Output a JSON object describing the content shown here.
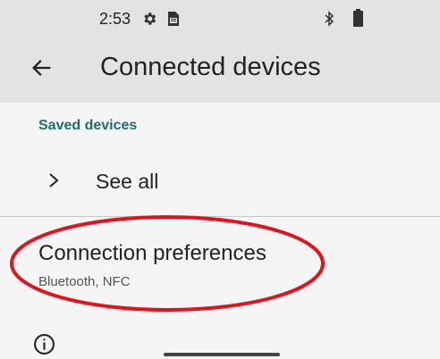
{
  "status_bar": {
    "time": "2:53",
    "icons": [
      "settings-gear-icon",
      "sim-card-icon",
      "bluetooth-icon",
      "battery-icon"
    ]
  },
  "app_bar": {
    "back_icon": "arrow-left-icon",
    "title": "Connected devices"
  },
  "saved_devices": {
    "header": "Saved devices",
    "see_all_label": "See all",
    "chevron_icon": "chevron-right-icon"
  },
  "connection_preferences": {
    "title": "Connection preferences",
    "subtitle": "Bluetooth, NFC",
    "highlight_color": "#e0141e"
  },
  "footer": {
    "info_icon": "info-icon"
  }
}
